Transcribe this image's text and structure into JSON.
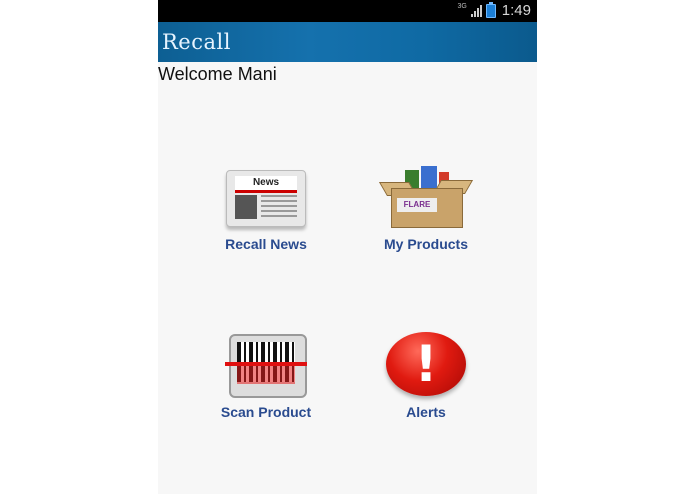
{
  "status_bar": {
    "network": "3G",
    "time": "1:49",
    "icons": [
      "signal-icon",
      "battery-icon"
    ]
  },
  "action_bar": {
    "title": "Recall"
  },
  "welcome_text": "Welcome Mani",
  "menu": [
    {
      "label": "Recall News",
      "icon": "newspaper-icon"
    },
    {
      "label": "My Products",
      "icon": "product-box-icon"
    },
    {
      "label": "Scan Product",
      "icon": "barcode-scanner-icon"
    },
    {
      "label": "Alerts",
      "icon": "alert-icon"
    }
  ],
  "icon_text": {
    "news_header": "News",
    "box_label": "FLARE"
  },
  "colors": {
    "action_bar": "#1571ad",
    "menu_label": "#2a4b8f",
    "alert_red": "#e01a10"
  }
}
